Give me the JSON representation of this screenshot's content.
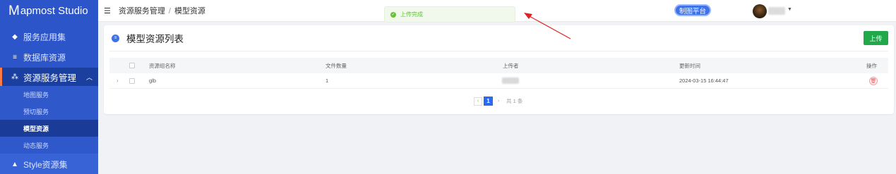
{
  "app": {
    "logo_mark": "M",
    "logo_text": "apmost Studio"
  },
  "sidebar": {
    "items": [
      {
        "label": "服务应用集",
        "icon": "layers-icon"
      },
      {
        "label": "数据库资源",
        "icon": "database-icon"
      },
      {
        "label": "资源服务管理",
        "icon": "cluster-icon",
        "expanded": true
      },
      {
        "label": "Style资源集",
        "icon": "brush-icon"
      }
    ],
    "sub_items": [
      "地图服务",
      "预切服务",
      "模型资源",
      "动态服务"
    ],
    "active_sub": "模型资源"
  },
  "header": {
    "menu_icon": "hamburger-icon",
    "breadcrumb": [
      "资源服务管理",
      "模型资源"
    ],
    "breadcrumb_sep": "/",
    "platform_button": "制图平台"
  },
  "toast": {
    "message": "上传完成",
    "type": "success"
  },
  "card": {
    "title": "模型资源列表",
    "upload_button": "上传"
  },
  "table": {
    "columns": [
      "资源组名称",
      "文件数量",
      "上传者",
      "更新时间",
      "操作"
    ],
    "rows": [
      {
        "name": "glb",
        "count": "1",
        "uploader": "",
        "updated": "2024-03-15 16:44:47"
      }
    ]
  },
  "pagination": {
    "current": "1",
    "total_text": "共 1 条"
  },
  "colors": {
    "sidebar_bg": "#2b55c8",
    "primary": "#3e72e9",
    "upload_green": "#21a84b",
    "toast_green": "#67c23a",
    "annotation_red": "#e02020"
  }
}
